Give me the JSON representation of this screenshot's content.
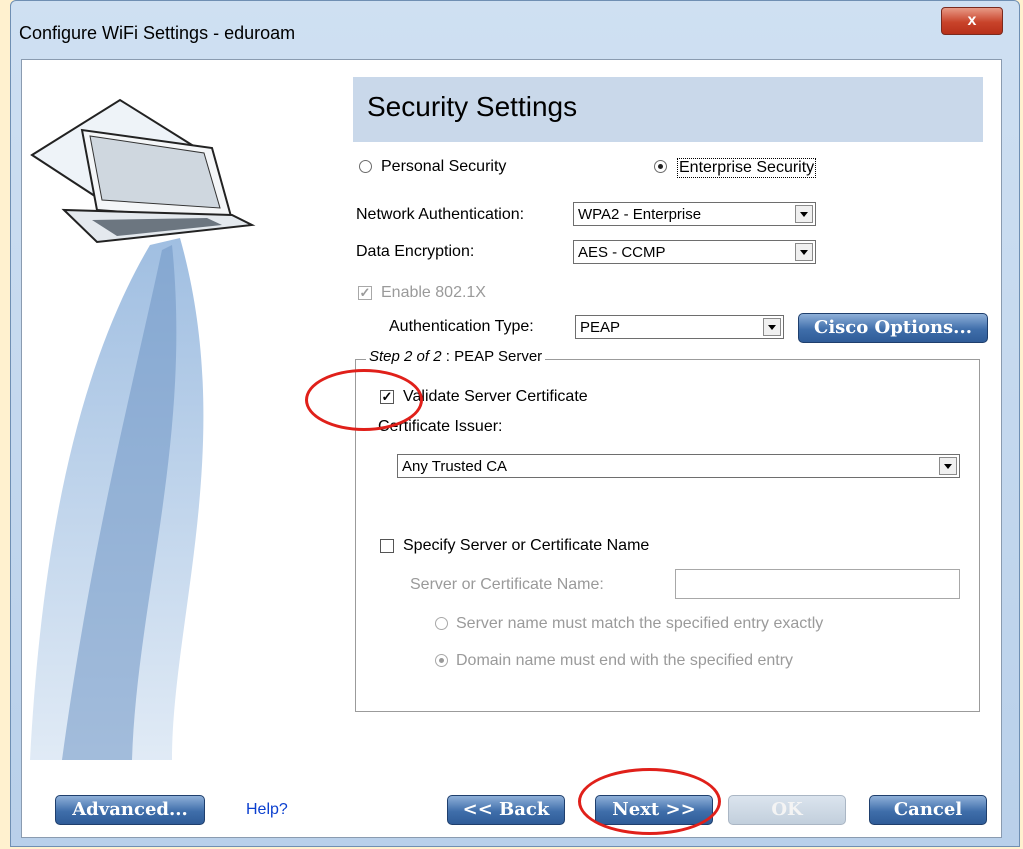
{
  "window": {
    "title": "Configure WiFi Settings - eduroam",
    "close_label": "x"
  },
  "header": {
    "title": "Security Settings"
  },
  "security_mode": {
    "personal_label": "Personal Security",
    "enterprise_label": "Enterprise Security",
    "selected": "Enterprise Security"
  },
  "network_authentication": {
    "label": "Network Authentication:",
    "value": "WPA2 - Enterprise"
  },
  "data_encryption": {
    "label": "Data Encryption:",
    "value": "AES - CCMP"
  },
  "enable_8021x": {
    "label": "Enable 802.1X",
    "checked": true
  },
  "authentication_type": {
    "label": "Authentication Type:",
    "value": "PEAP"
  },
  "cisco_options_label": "Cisco Options...",
  "step_group": {
    "legend_step": "Step 2 of 2",
    "legend_rest": " : PEAP Server"
  },
  "validate_server_cert": {
    "label": "Validate Server Certificate",
    "checked": true
  },
  "certificate_issuer": {
    "label": "Certificate Issuer:",
    "value": "Any Trusted CA"
  },
  "specify_server": {
    "label": "Specify Server or Certificate Name",
    "checked": false
  },
  "server_name": {
    "label": "Server or Certificate Name:",
    "value": ""
  },
  "match_options": {
    "exact": "Server name must match the specified entry exactly",
    "domain": "Domain name must end with the specified entry",
    "selected": "Domain name must end with the specified entry"
  },
  "footer": {
    "advanced_label": "Advanced...",
    "help_label": "Help?",
    "back_label": "<< Back",
    "next_label": "Next >>",
    "ok_label": "OK",
    "cancel_label": "Cancel"
  },
  "colors": {
    "accent": "#3f6eaa",
    "header_band": "#c9d8ea",
    "annotation": "#e0201a",
    "page_bg": "#fff1cf"
  }
}
